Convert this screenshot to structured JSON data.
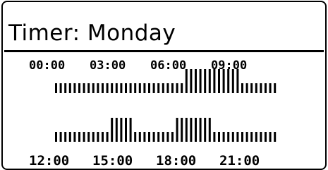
{
  "header": {
    "title": "Timer: Monday"
  },
  "top_row": {
    "labels": [
      "00:00",
      "03:00",
      "06:00",
      "09:00"
    ],
    "slots": [
      0,
      0,
      0,
      0,
      0,
      0,
      0,
      0,
      0,
      0,
      0,
      0,
      0,
      0,
      0,
      0,
      0,
      0,
      0,
      0,
      0,
      0,
      0,
      0,
      0,
      0,
      0,
      0,
      1,
      1,
      1,
      1,
      1,
      1,
      1,
      1,
      1,
      1,
      1,
      1,
      0,
      0,
      0,
      0,
      0,
      0,
      0,
      0
    ]
  },
  "bottom_row": {
    "labels": [
      "12:00",
      "15:00",
      "18:00",
      "21:00"
    ],
    "slots": [
      0,
      0,
      0,
      0,
      0,
      0,
      0,
      0,
      0,
      0,
      0,
      0,
      1,
      1,
      1,
      1,
      1,
      0,
      0,
      0,
      0,
      0,
      0,
      0,
      0,
      0,
      1,
      1,
      1,
      1,
      1,
      1,
      1,
      1,
      0,
      0,
      0,
      0,
      0,
      0,
      0,
      0,
      0,
      0,
      0,
      0,
      0,
      0
    ]
  }
}
